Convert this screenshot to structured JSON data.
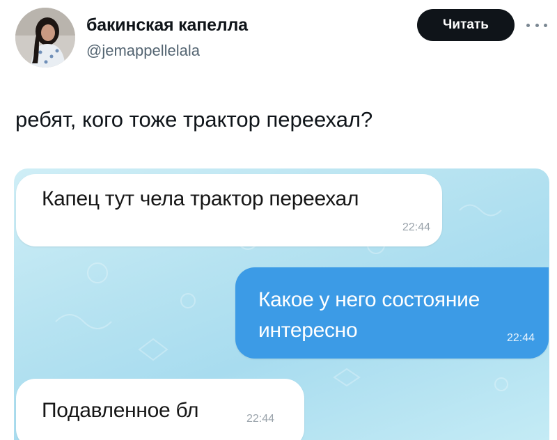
{
  "author": {
    "display_name": "бакинская капелла",
    "handle": "@jemappellelala"
  },
  "actions": {
    "follow_label": "Читать"
  },
  "tweet": {
    "text": "ребят, кого тоже трактор переехал?"
  },
  "chat": {
    "messages": [
      {
        "direction": "incoming",
        "text": "Капец тут чела трактор переехал",
        "time": "22:44"
      },
      {
        "direction": "outgoing",
        "text": "Какое у него состояние интересно",
        "time": "22:44"
      },
      {
        "direction": "incoming",
        "text": "Подавленное бл",
        "time": "22:44"
      }
    ]
  },
  "icons": {
    "more": "more-dots-icon",
    "avatar": "profile-avatar"
  },
  "colors": {
    "follow_button_bg": "#0f1419",
    "outgoing_bubble": "#3c9be6",
    "chat_background": "#b7e3f1",
    "handle_text": "#536471"
  }
}
